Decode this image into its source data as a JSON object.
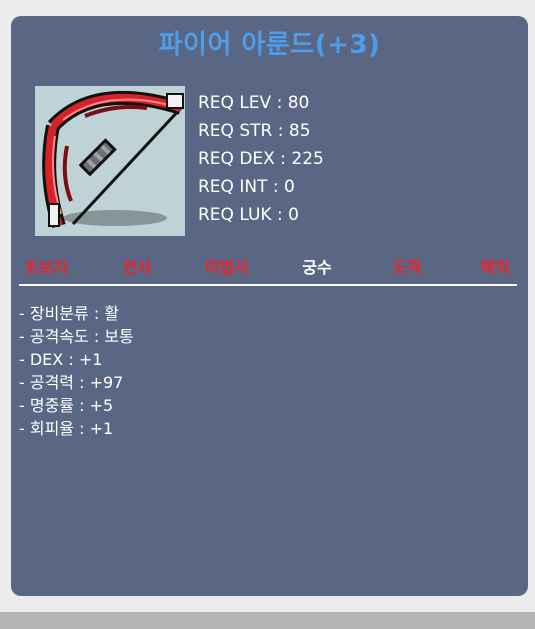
{
  "item": {
    "name": "파이어 아룬드(+3)",
    "image_icon": "bow-icon"
  },
  "requirements": [
    {
      "label": "REQ LEV",
      "value": "80"
    },
    {
      "label": "REQ STR",
      "value": "85"
    },
    {
      "label": "REQ DEX",
      "value": "225"
    },
    {
      "label": "REQ INT",
      "value": "0"
    },
    {
      "label": "REQ LUK",
      "value": "0"
    }
  ],
  "classes": [
    {
      "label": "초보자",
      "color": "#e8262b"
    },
    {
      "label": "전사",
      "color": "#e8262b"
    },
    {
      "label": "마법사",
      "color": "#e8262b"
    },
    {
      "label": "궁수",
      "color": "#ffffff"
    },
    {
      "label": "도적",
      "color": "#e8262b"
    },
    {
      "label": "해적",
      "color": "#e8262b"
    }
  ],
  "stats": [
    "- 장비분류 : 활",
    "- 공격속도 : 보통",
    "- DEX : +1",
    "- 공격력 : +97",
    "- 명중률 : +5",
    "- 회피율 : +1"
  ],
  "colors": {
    "title": "#4f9ce8",
    "panel": "#596785",
    "restricted_class": "#e8262b",
    "allowed_class": "#ffffff"
  }
}
